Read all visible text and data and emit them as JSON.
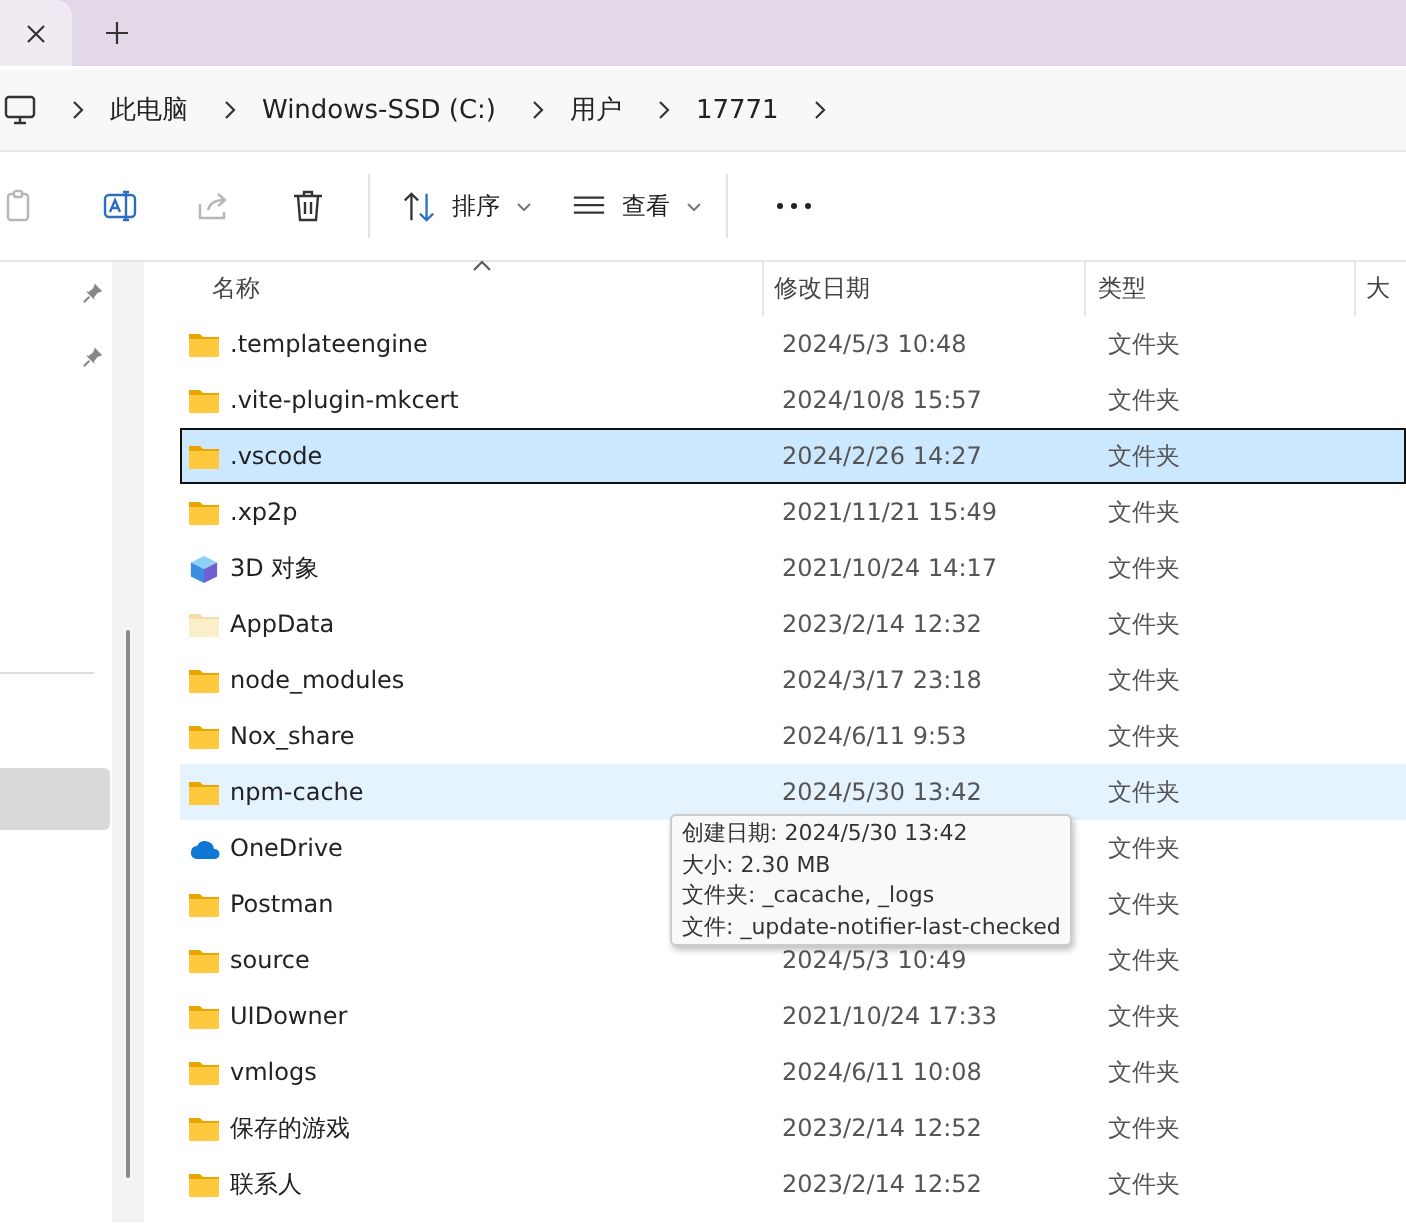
{
  "breadcrumb": [
    "此电脑",
    "Windows-SSD (C:)",
    "用户",
    "17771"
  ],
  "toolbar": {
    "buttons": [
      {
        "disabled": true
      },
      {
        "disabled": false
      },
      {
        "disabled": true
      },
      {
        "disabled": false
      }
    ],
    "menus": [
      {
        "label": "排序"
      },
      {
        "label": "查看"
      }
    ]
  },
  "columns": [
    {
      "label": "名称",
      "sorted": true
    },
    {
      "label": "修改日期",
      "sorted": false
    },
    {
      "label": "类型",
      "sorted": false
    },
    {
      "label": "大",
      "sorted": false
    }
  ],
  "rows": [
    {
      "kind": "folder",
      "name": ".templateengine",
      "date": "2024/5/3 10:48",
      "type": "文件夹",
      "selected": false,
      "hovered": false
    },
    {
      "kind": "folder",
      "name": ".vite-plugin-mkcert",
      "date": "2024/10/8 15:57",
      "type": "文件夹",
      "selected": false,
      "hovered": false
    },
    {
      "kind": "folder",
      "name": ".vscode",
      "date": "2024/2/26 14:27",
      "type": "文件夹",
      "selected": true,
      "hovered": false
    },
    {
      "kind": "folder",
      "name": ".xp2p",
      "date": "2021/11/21 15:49",
      "type": "文件夹",
      "selected": false,
      "hovered": false
    },
    {
      "kind": "objects3d",
      "name": "3D 对象",
      "date": "2021/10/24 14:17",
      "type": "文件夹",
      "selected": false,
      "hovered": false
    },
    {
      "kind": "hidden-folder",
      "name": "AppData",
      "date": "2023/2/14 12:32",
      "type": "文件夹",
      "selected": false,
      "hovered": false
    },
    {
      "kind": "folder",
      "name": "node_modules",
      "date": "2024/3/17 23:18",
      "type": "文件夹",
      "selected": false,
      "hovered": false
    },
    {
      "kind": "folder",
      "name": "Nox_share",
      "date": "2024/6/11 9:53",
      "type": "文件夹",
      "selected": false,
      "hovered": false
    },
    {
      "kind": "folder",
      "name": "npm-cache",
      "date": "2024/5/30 13:42",
      "type": "文件夹",
      "selected": false,
      "hovered": true
    },
    {
      "kind": "cloud",
      "name": "OneDrive",
      "type": "文件夹",
      "selected": false,
      "hovered": false
    },
    {
      "kind": "folder",
      "name": "Postman",
      "type": "文件夹",
      "selected": false,
      "hovered": false
    },
    {
      "kind": "folder",
      "name": "source",
      "date": "2024/5/3 10:49",
      "type": "文件夹",
      "selected": false,
      "hovered": false
    },
    {
      "kind": "folder",
      "name": "UIDowner",
      "date": "2021/10/24 17:33",
      "type": "文件夹",
      "selected": false,
      "hovered": false
    },
    {
      "kind": "folder",
      "name": "vmlogs",
      "date": "2024/6/11 10:08",
      "type": "文件夹",
      "selected": false,
      "hovered": false
    },
    {
      "kind": "folder",
      "name": "保存的游戏",
      "date": "2023/2/14 12:52",
      "type": "文件夹",
      "selected": false,
      "hovered": false
    },
    {
      "kind": "folder",
      "name": "联系人",
      "date": "2023/2/14 12:52",
      "type": "文件夹",
      "selected": false,
      "hovered": false
    }
  ],
  "tooltip": [
    "创建日期: 2024/5/30 13:42",
    "大小: 2.30 MB",
    "文件夹: _cacache, _logs",
    "文件: _update-notifier-last-checked"
  ]
}
